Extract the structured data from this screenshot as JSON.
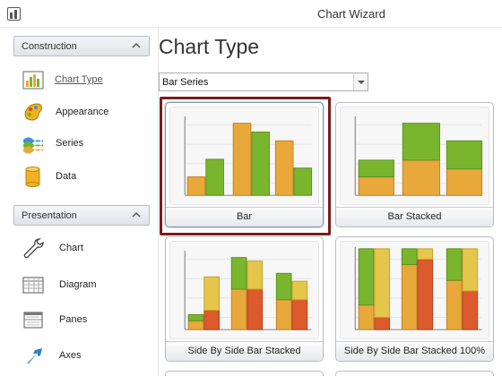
{
  "window": {
    "title": "Chart Wizard"
  },
  "sidebar": {
    "sections": [
      {
        "label": "Construction",
        "items": [
          {
            "label": "Chart Type",
            "icon": "bar-chart-icon",
            "active": true
          },
          {
            "label": "Appearance",
            "icon": "palette-icon"
          },
          {
            "label": "Series",
            "icon": "series-icon"
          },
          {
            "label": "Data",
            "icon": "database-icon"
          }
        ]
      },
      {
        "label": "Presentation",
        "items": [
          {
            "label": "Chart",
            "icon": "wrench-icon"
          },
          {
            "label": "Diagram",
            "icon": "grid-icon"
          },
          {
            "label": "Panes",
            "icon": "panes-icon"
          },
          {
            "label": "Axes",
            "icon": "axes-arrow-icon"
          }
        ]
      }
    ]
  },
  "main": {
    "title": "Chart Type",
    "series_select": {
      "value": "Bar Series"
    },
    "gallery": [
      {
        "label": "Bar",
        "selected": true
      },
      {
        "label": "Bar Stacked"
      },
      {
        "label": "Side By Side Bar Stacked"
      },
      {
        "label": "Side By Side Bar Stacked 100%"
      }
    ]
  },
  "colors": {
    "accent_selection": "#7a1c1c",
    "bar_orange": "#e8a83a",
    "bar_green": "#7ab52e",
    "bar_yellow": "#e6c64a",
    "bar_red": "#dc5a2c"
  }
}
